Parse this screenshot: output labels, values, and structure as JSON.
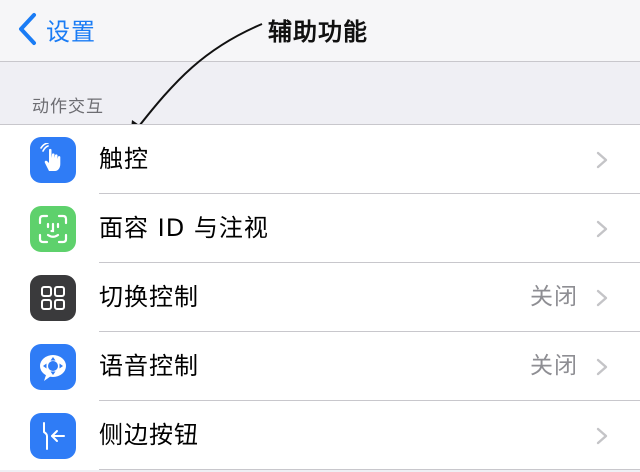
{
  "nav": {
    "back_label": "设置",
    "back_icon": "chevron-left-icon",
    "accent": "#1a7cf5"
  },
  "annotation": {
    "text": "辅助功能"
  },
  "section": {
    "header": "动作交互"
  },
  "rows": [
    {
      "label": "触控",
      "value": "",
      "icon": "hand-pointer-icon",
      "icon_color": "#2f7cf6"
    },
    {
      "label": "面容 ID 与注视",
      "value": "",
      "icon": "face-id-icon",
      "icon_color": "#5ed16c"
    },
    {
      "label": "切换控制",
      "value": "关闭",
      "icon": "switch-control-icon",
      "icon_color": "#3a3a3c"
    },
    {
      "label": "语音控制",
      "value": "关闭",
      "icon": "voice-control-icon",
      "icon_color": "#2f7cf6"
    },
    {
      "label": "侧边按钮",
      "value": "",
      "icon": "side-button-icon",
      "icon_color": "#2f7cf6"
    }
  ]
}
